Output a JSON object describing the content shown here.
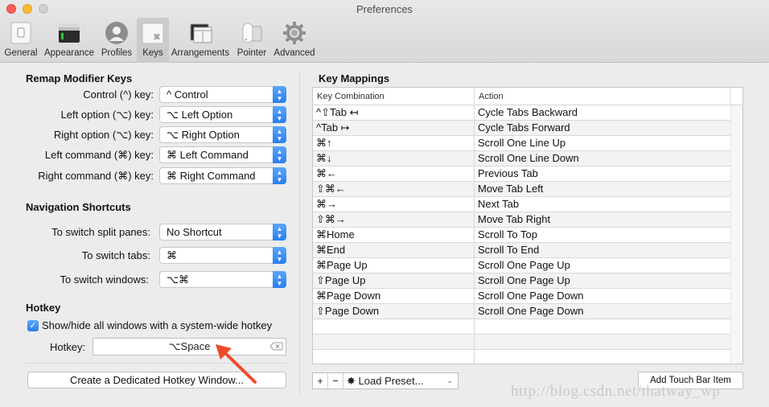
{
  "window": {
    "title": "Preferences"
  },
  "toolbar": {
    "items": [
      {
        "label": "General",
        "icon": "general-icon",
        "active": false
      },
      {
        "label": "Appearance",
        "icon": "appearance-icon",
        "active": false
      },
      {
        "label": "Profiles",
        "icon": "profiles-icon",
        "active": false
      },
      {
        "label": "Keys",
        "icon": "keys-icon",
        "active": true
      },
      {
        "label": "Arrangements",
        "icon": "arrangements-icon",
        "active": false
      },
      {
        "label": "Pointer",
        "icon": "pointer-icon",
        "active": false
      },
      {
        "label": "Advanced",
        "icon": "gear-icon",
        "active": false
      }
    ]
  },
  "remap": {
    "title": "Remap Modifier Keys",
    "rows": [
      {
        "label": "Control (^) key:",
        "value": "^ Control"
      },
      {
        "label": "Left option (⌥) key:",
        "value": "⌥ Left Option"
      },
      {
        "label": "Right option (⌥) key:",
        "value": "⌥ Right Option"
      },
      {
        "label": "Left command (⌘) key:",
        "value": "⌘ Left Command"
      },
      {
        "label": "Right command (⌘) key:",
        "value": "⌘ Right Command"
      }
    ]
  },
  "navigation": {
    "title": "Navigation Shortcuts",
    "rows": [
      {
        "label": "To switch split panes:",
        "value": "No Shortcut"
      },
      {
        "label": "To switch tabs:",
        "value": "⌘"
      },
      {
        "label": "To switch windows:",
        "value": "⌥⌘"
      }
    ]
  },
  "hotkey": {
    "title": "Hotkey",
    "checkbox_label": "Show/hide all windows with a system-wide hotkey",
    "checked": true,
    "field_label": "Hotkey:",
    "field_value": "⌥Space",
    "create_button": "Create a Dedicated Hotkey Window..."
  },
  "key_mappings": {
    "title": "Key Mappings",
    "columns": [
      "Key Combination",
      "Action"
    ],
    "rows": [
      {
        "key": "^⇧Tab ↤",
        "action": "Cycle Tabs Backward"
      },
      {
        "key": "^Tab ↦",
        "action": "Cycle Tabs Forward"
      },
      {
        "key": "⌘↑",
        "action": "Scroll One Line Up"
      },
      {
        "key": "⌘↓",
        "action": "Scroll One Line Down"
      },
      {
        "key": "⌘←",
        "action": "Previous Tab"
      },
      {
        "key": "⇧⌘←",
        "action": "Move Tab Left"
      },
      {
        "key": "⌘→",
        "action": "Next Tab"
      },
      {
        "key": "⇧⌘→",
        "action": "Move Tab Right"
      },
      {
        "key": "⌘Home",
        "action": "Scroll To Top"
      },
      {
        "key": "⌘End",
        "action": "Scroll To End"
      },
      {
        "key": "⌘Page Up",
        "action": "Scroll One Page Up"
      },
      {
        "key": "⇧Page Up",
        "action": "Scroll One Page Up"
      },
      {
        "key": "⌘Page Down",
        "action": "Scroll One Page Down"
      },
      {
        "key": "⇧Page Down",
        "action": "Scroll One Page Down"
      },
      {
        "key": "",
        "action": ""
      },
      {
        "key": "",
        "action": ""
      },
      {
        "key": "",
        "action": ""
      }
    ],
    "add_label": "+",
    "remove_label": "−",
    "load_preset_label": "Load Preset...",
    "touch_bar_button": "Add Touch Bar Item"
  },
  "watermark": "http://blog.csdn.net/thatway_wp",
  "colors": {
    "accent": "#2a7ef0",
    "arrow": "#ee4b2b"
  }
}
